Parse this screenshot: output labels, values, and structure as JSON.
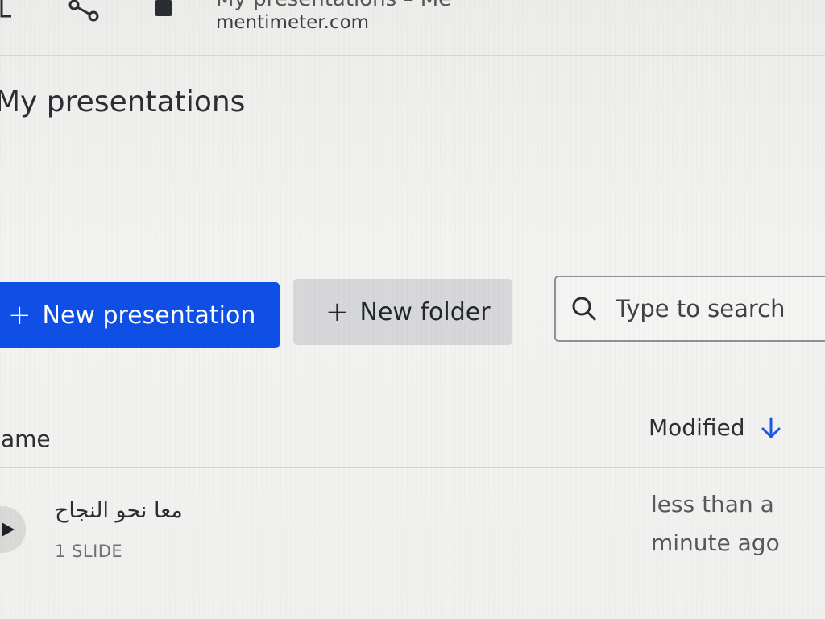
{
  "browser": {
    "tab_title": "My presentations – Me",
    "domain": "mentimeter.com",
    "icons": [
      "back-icon",
      "share-icon",
      "lock-icon"
    ]
  },
  "page": {
    "title": "My presentations"
  },
  "actions": {
    "new_presentation": {
      "plus": "+",
      "label": "New presentation"
    },
    "new_folder": {
      "plus": "+",
      "label": "New folder"
    },
    "search": {
      "placeholder": "Type to search",
      "value": ""
    }
  },
  "table": {
    "columns": {
      "name": "Name",
      "modified": "Modified"
    },
    "sort": {
      "column": "modified",
      "direction": "descending"
    },
    "rows": [
      {
        "title": "معا نحو النجاح",
        "slides": "1 SLIDE",
        "modified": "less than a minute ago"
      }
    ]
  },
  "colors": {
    "primary": "#0f4fe6",
    "secondary_button": "#d6d7d8",
    "sort_arrow": "#1a56e8"
  }
}
